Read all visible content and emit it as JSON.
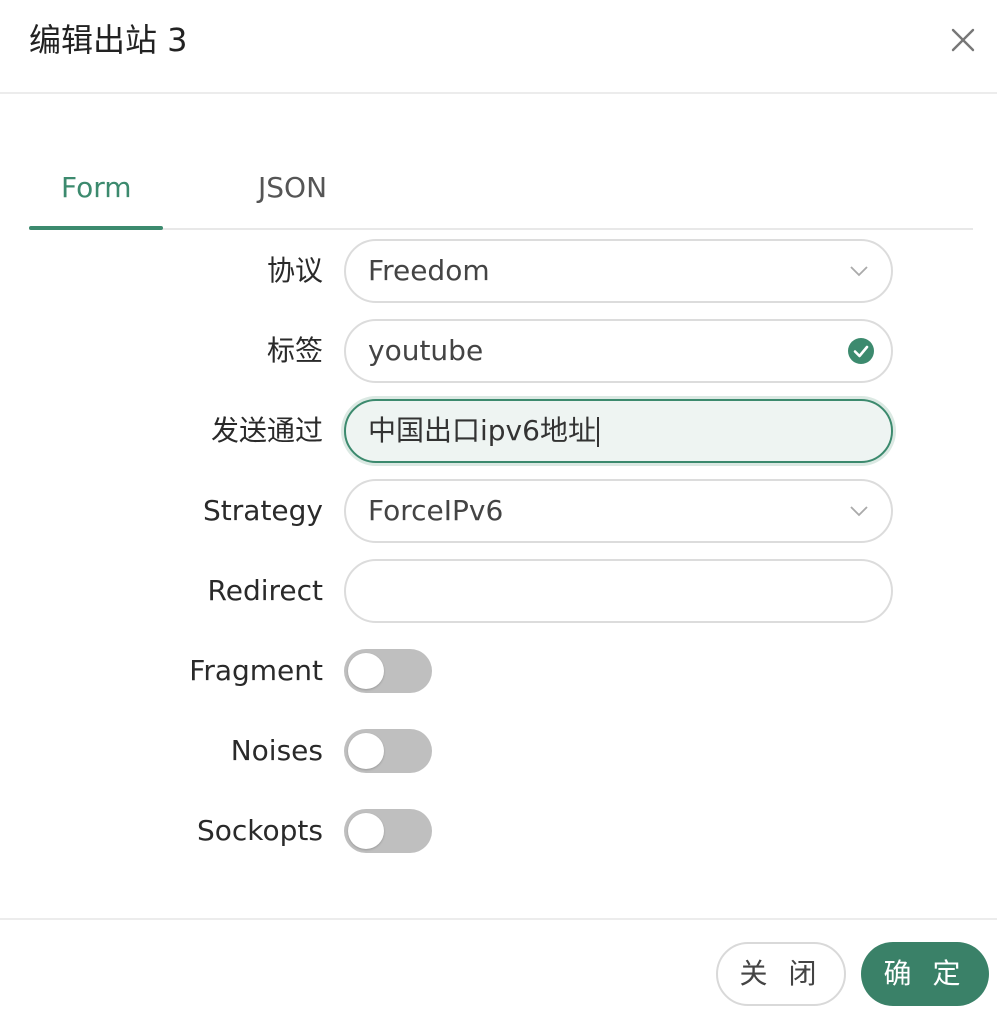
{
  "dialog": {
    "title": "编辑出站 3",
    "close_icon": "close-icon"
  },
  "tabs": [
    {
      "label": "Form",
      "active": true
    },
    {
      "label": "JSON",
      "active": false
    }
  ],
  "form": {
    "protocol": {
      "label": "协议",
      "value": "Freedom"
    },
    "tag": {
      "label": "标签",
      "value": "youtube",
      "valid": true
    },
    "send_through": {
      "label": "发送通过",
      "value": "中国出口ipv6地址"
    },
    "strategy": {
      "label": "Strategy",
      "value": "ForceIPv6"
    },
    "redirect": {
      "label": "Redirect",
      "value": ""
    },
    "fragment": {
      "label": "Fragment",
      "enabled": false
    },
    "noises": {
      "label": "Noises",
      "enabled": false
    },
    "sockopts": {
      "label": "Sockopts",
      "enabled": false
    }
  },
  "footer": {
    "cancel_label": "关 闭",
    "ok_label": "确 定"
  },
  "colors": {
    "accent": "#3c8a6e",
    "primary_button": "#3a8168",
    "switch_off": "#bfbfbf"
  }
}
